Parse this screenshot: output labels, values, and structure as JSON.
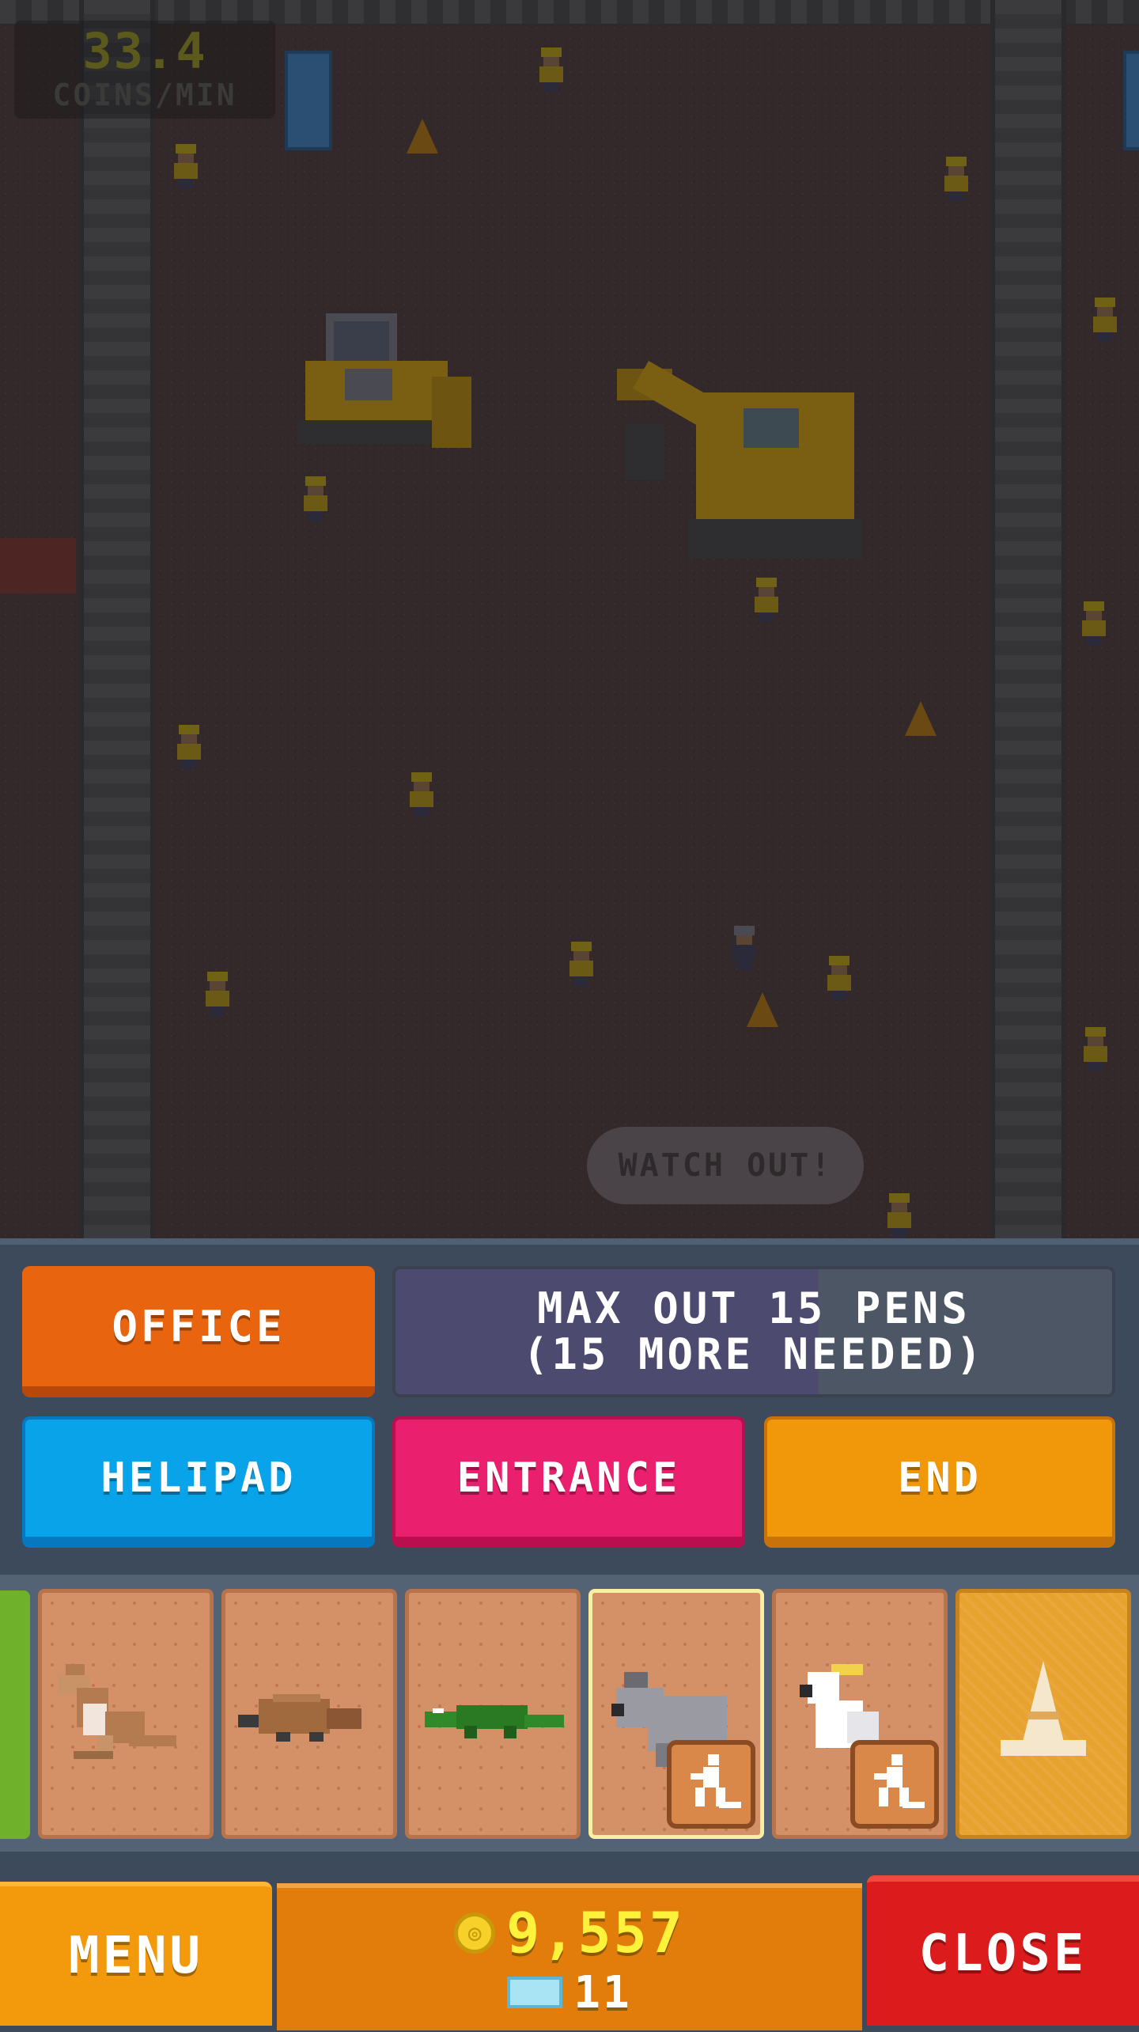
{
  "hud": {
    "rate_value": "33.4",
    "rate_label": "COINS/MIN"
  },
  "world": {
    "speech_bubble": "WATCH OUT!"
  },
  "controls": {
    "office_label": "OFFICE",
    "goal_line1": "MAX OUT 15 PENS",
    "goal_line2": "(15 MORE NEEDED)",
    "helipad_label": "HELIPAD",
    "entrance_label": "ENTRANCE",
    "end_label": "END"
  },
  "tray": {
    "items": [
      {
        "name": "kangaroo",
        "selected": false,
        "badge": false
      },
      {
        "name": "platypus",
        "selected": false,
        "badge": false
      },
      {
        "name": "crocodile",
        "selected": false,
        "badge": false
      },
      {
        "name": "koala",
        "selected": true,
        "badge": true
      },
      {
        "name": "cockatoo",
        "selected": false,
        "badge": true
      },
      {
        "name": "cone",
        "selected": false,
        "badge": false
      }
    ]
  },
  "bottom_bar": {
    "menu_label": "MENU",
    "coins": "9,557",
    "gems": "11",
    "close_label": "CLOSE"
  },
  "colors": {
    "office": "#e8640f",
    "helipad": "#09a3ea",
    "entrance": "#ea1f6d",
    "end": "#f0980a",
    "menu": "#f29a0c",
    "close": "#dc1c1c",
    "coins_text": "#fff23a"
  }
}
